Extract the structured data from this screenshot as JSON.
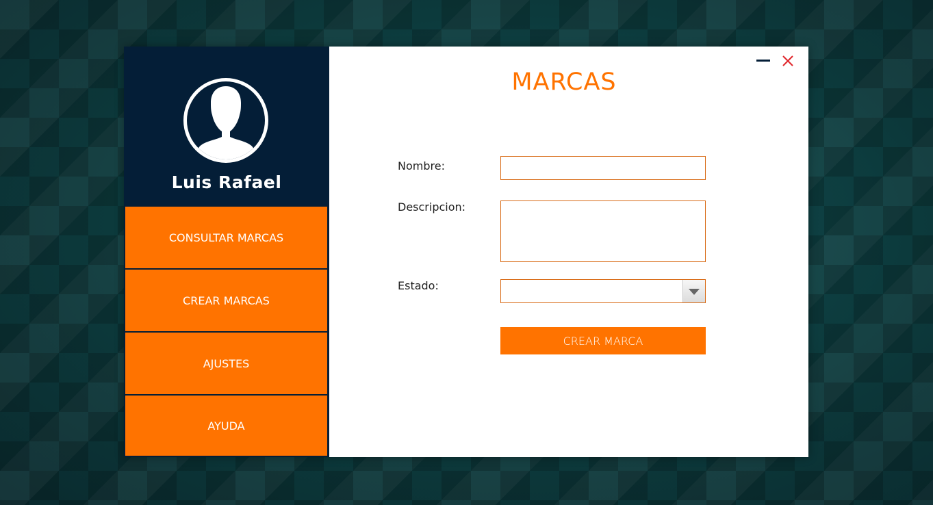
{
  "user": {
    "name": "Luis Rafael",
    "avatar_icon": "user-avatar-icon"
  },
  "menu": {
    "items": [
      {
        "label": "CONSULTAR MARCAS"
      },
      {
        "label": "CREAR MARCAS"
      },
      {
        "label": "AJUSTES"
      },
      {
        "label": "AYUDA"
      }
    ]
  },
  "window_controls": {
    "minimize_icon": "minimize-icon",
    "close_icon": "close-icon"
  },
  "form": {
    "title": "MARCAS",
    "nombre_label": "Nombre:",
    "nombre_value": "",
    "descripcion_label": "Descripcion:",
    "descripcion_value": "",
    "estado_label": "Estado:",
    "estado_value": "",
    "submit_label": "CREAR MARCA"
  },
  "colors": {
    "accent": "#ff7300",
    "sidebar_bg": "#041e37",
    "close": "#e0252b"
  }
}
